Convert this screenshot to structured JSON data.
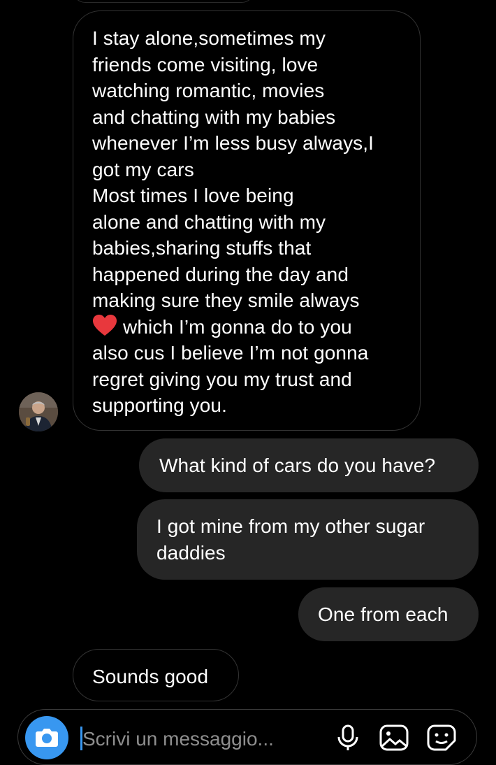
{
  "conversation": {
    "messages": [
      {
        "direction": "incoming",
        "text_before_emoji": "I  stay alone,sometimes my\nfriends come visiting, love\nwatching romantic, movies\nand chatting with my babies\nwhenever I’m less busy always,I\ngot my cars\nMost times I love being\nalone and chatting with my\nbabies,sharing stuffs that\nhappened during the day and\nmaking sure they smile always\n",
        "emoji": "heart",
        "text_after_emoji": "which I’m gonna do to you\nalso cus I believe I’m not gonna\nregret giving you my trust and\nsupporting you."
      },
      {
        "direction": "outgoing",
        "text": "What kind of cars do you have?"
      },
      {
        "direction": "outgoing",
        "text": "I got mine from my other sugar\ndaddies"
      },
      {
        "direction": "outgoing",
        "text": "One from each"
      },
      {
        "direction": "incoming",
        "text": "Sounds good"
      }
    ]
  },
  "composer": {
    "placeholder": "Scrivi un messaggio...",
    "icons": [
      "camera-icon",
      "mic-icon",
      "gallery-icon",
      "sticker-icon"
    ]
  },
  "colors": {
    "background": "#000000",
    "outgoing_bubble": "#262626",
    "incoming_border": "#333333",
    "accent": "#3897f0",
    "heart": "#e8383d"
  }
}
